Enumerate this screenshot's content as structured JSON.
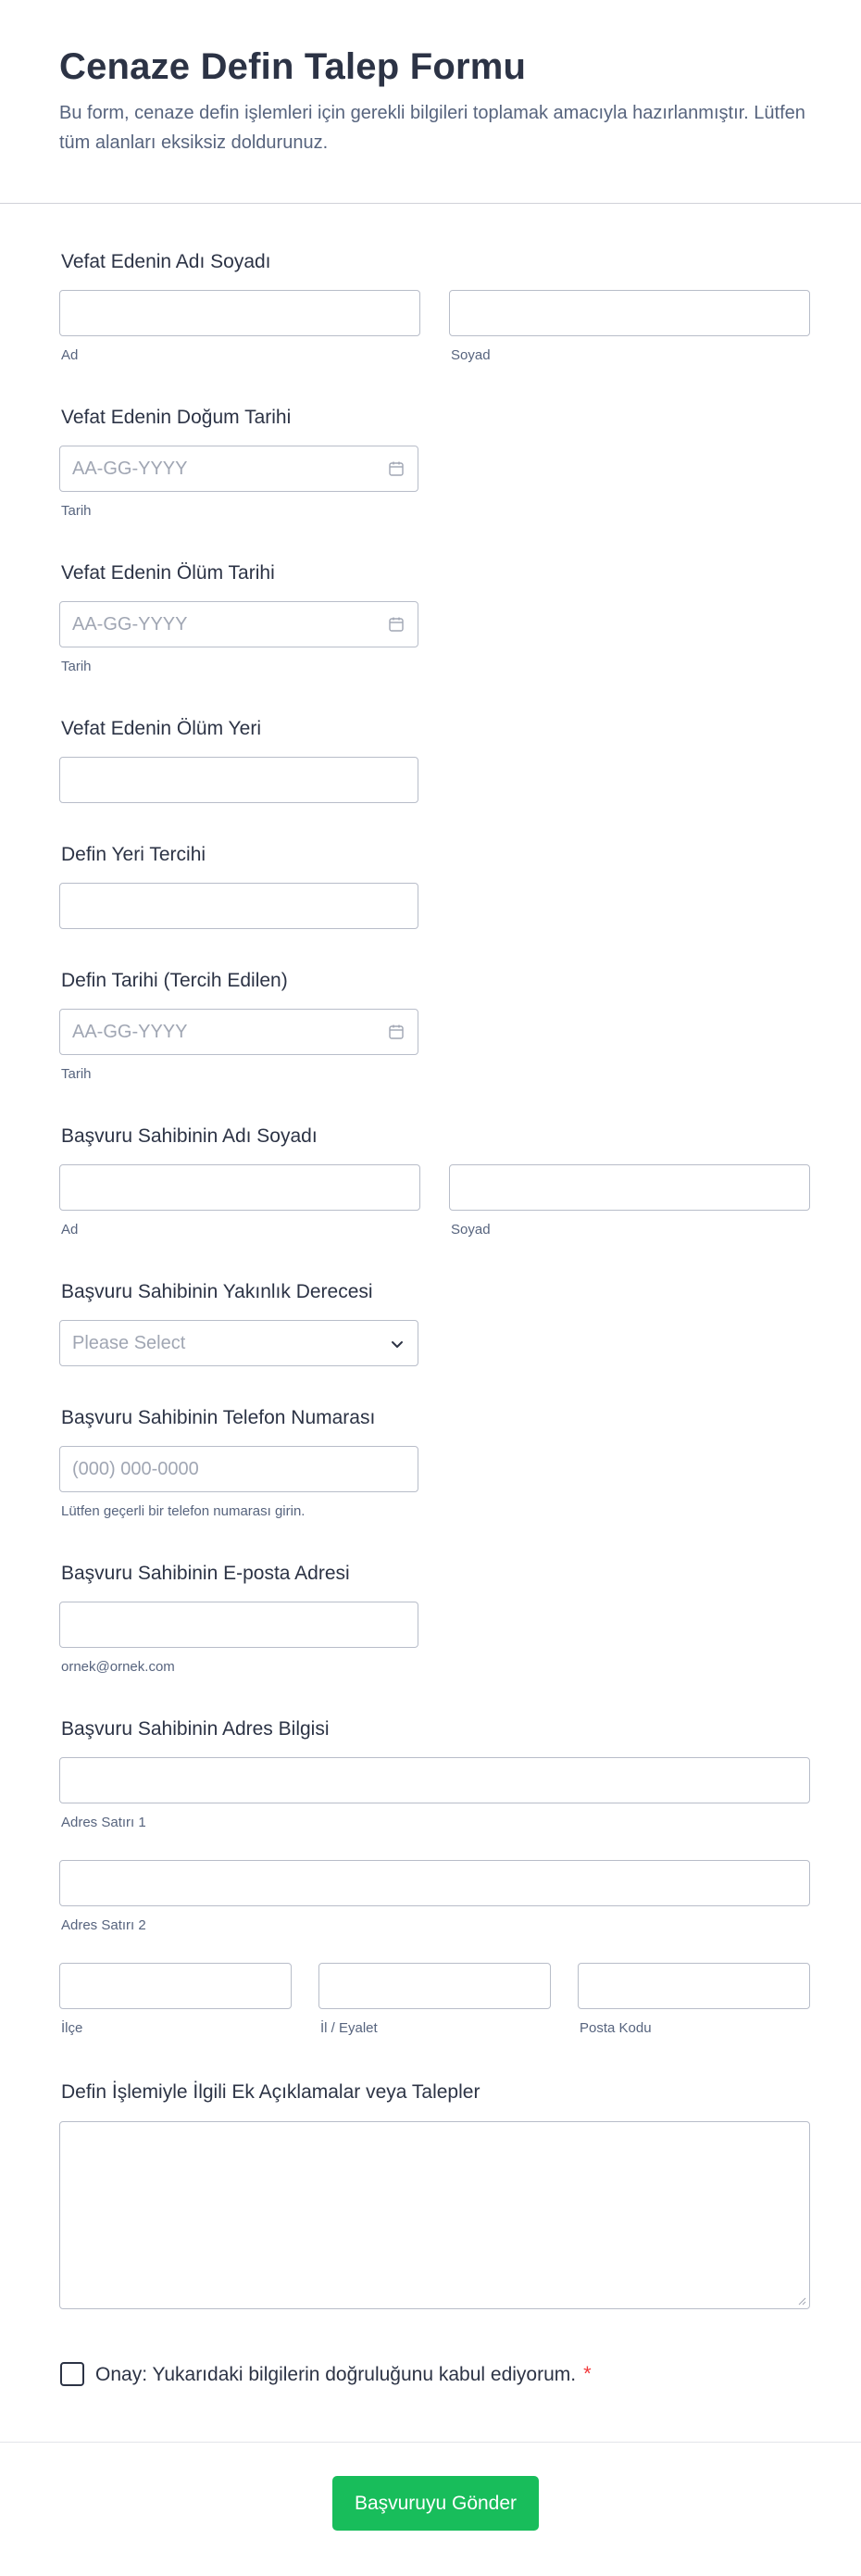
{
  "header": {
    "title": "Cenaze Defin Talep Formu",
    "description": "Bu form, cenaze defin işlemleri için gerekli bilgileri toplamak amacıyla hazırlanmıştır. Lütfen tüm alanları eksiksiz doldurunuz."
  },
  "fields": {
    "deceased_name": {
      "label": "Vefat Edenin Adı Soyadı",
      "first_sub": "Ad",
      "last_sub": "Soyad",
      "first_value": "",
      "last_value": ""
    },
    "birth_date": {
      "label": "Vefat Edenin Doğum Tarihi",
      "placeholder": "AA-GG-YYYY",
      "sub": "Tarih"
    },
    "death_date": {
      "label": "Vefat Edenin Ölüm Tarihi",
      "placeholder": "AA-GG-YYYY",
      "sub": "Tarih"
    },
    "death_place": {
      "label": "Vefat Edenin Ölüm Yeri",
      "value": ""
    },
    "burial_place": {
      "label": "Defin Yeri Tercihi",
      "value": ""
    },
    "burial_date": {
      "label": "Defin Tarihi (Tercih Edilen)",
      "placeholder": "AA-GG-YYYY",
      "sub": "Tarih"
    },
    "applicant_name": {
      "label": "Başvuru Sahibinin Adı Soyadı",
      "first_sub": "Ad",
      "last_sub": "Soyad",
      "first_value": "",
      "last_value": ""
    },
    "relationship": {
      "label": "Başvuru Sahibinin Yakınlık Derecesi",
      "selected": "Please Select"
    },
    "phone": {
      "label": "Başvuru Sahibinin Telefon Numarası",
      "placeholder": "(000) 000-0000",
      "sub": "Lütfen geçerli bir telefon numarası girin."
    },
    "email": {
      "label": "Başvuru Sahibinin E-posta Adresi",
      "sub": "ornek@ornek.com",
      "value": ""
    },
    "address": {
      "label": "Başvuru Sahibinin Adres Bilgisi",
      "line1_sub": "Adres Satırı 1",
      "line2_sub": "Adres Satırı 2",
      "district_sub": "İlçe",
      "province_sub": "İl / Eyalet",
      "postal_sub": "Posta Kodu"
    },
    "notes": {
      "label": "Defin İşlemiyle İlgili Ek Açıklamalar veya Talepler",
      "value": ""
    },
    "consent": {
      "label": "Onay: Yukarıdaki bilgilerin doğruluğunu kabul ediyorum.",
      "required_mark": "*",
      "checked": false
    }
  },
  "submit": {
    "label": "Başvuruyu Gönder",
    "color": "#18bd5b"
  },
  "icons": {
    "date": "calendar-icon",
    "select": "chevron-down-icon"
  }
}
